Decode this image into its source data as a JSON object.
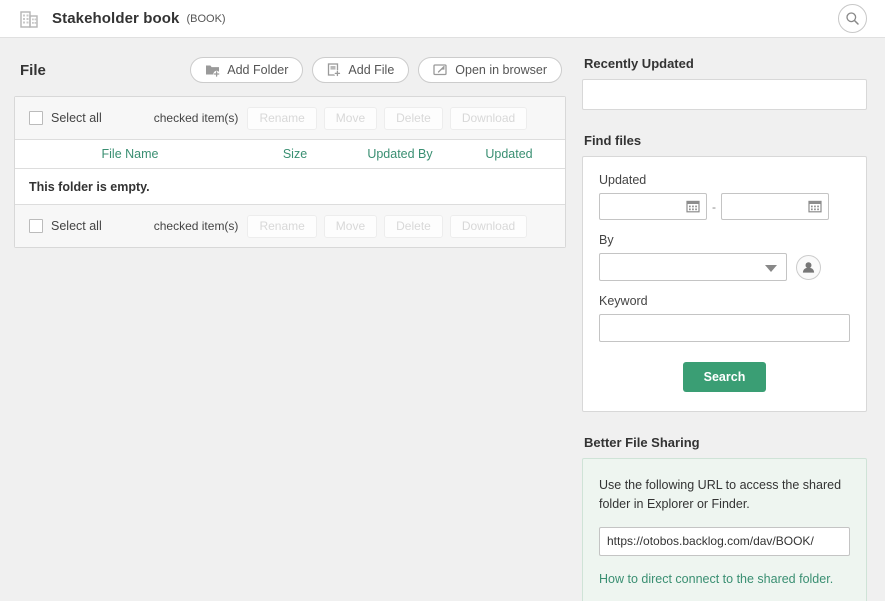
{
  "header": {
    "project_title": "Stakeholder book",
    "project_key": "(BOOK)",
    "project_icon": "building-icon",
    "search_icon": "search-icon"
  },
  "file_section": {
    "heading": "File",
    "actions": [
      {
        "label": "Add Folder",
        "icon": "add-folder-icon"
      },
      {
        "label": "Add File",
        "icon": "add-file-icon"
      },
      {
        "label": "Open in browser",
        "icon": "open-in-browser-icon"
      }
    ],
    "bulk_bar": {
      "select_all_label": "Select all",
      "checked_items_label": "checked item(s)",
      "buttons": [
        "Rename",
        "Move",
        "Delete",
        "Download"
      ]
    },
    "columns": [
      "File Name",
      "Size",
      "Updated By",
      "Updated"
    ],
    "empty_message": "This folder is empty."
  },
  "recently_updated": {
    "title": "Recently Updated",
    "items": []
  },
  "find_files": {
    "title": "Find files",
    "updated_label": "Updated",
    "date_from": "",
    "date_to": "",
    "date_separator": "-",
    "calendar_icon": "calendar-icon",
    "by_label": "By",
    "by_value": "",
    "by_picker_icon": "user-avatar-icon",
    "keyword_label": "Keyword",
    "keyword_value": "",
    "search_button": "Search"
  },
  "better_file_sharing": {
    "title": "Better File Sharing",
    "description": "Use the following URL to access the shared folder in Explorer or Finder.",
    "url": "https://otobos.backlog.com/dav/BOOK/",
    "link_text": "How to direct connect to the shared folder."
  },
  "colors": {
    "accent_green": "#3a9e74",
    "link_green": "#3a8f72",
    "page_bg": "#f0f0f0",
    "share_bg": "#eef5f0"
  }
}
